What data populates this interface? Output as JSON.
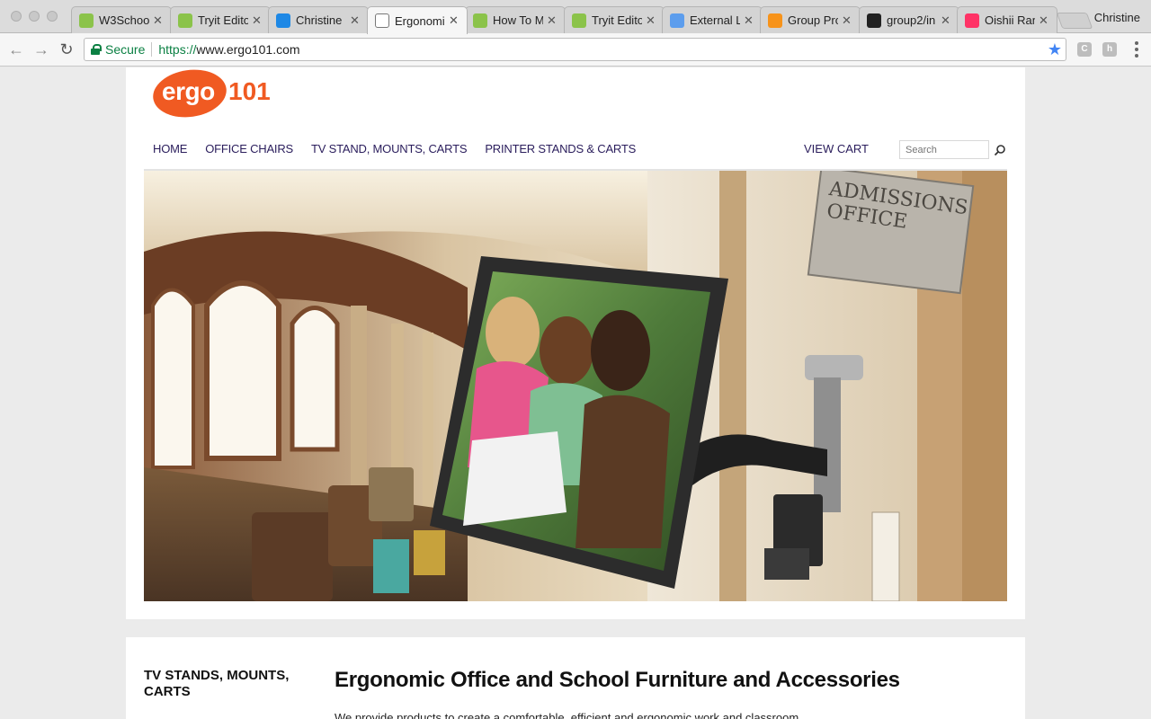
{
  "browser": {
    "tabs": [
      {
        "label": "W3Schoo",
        "icon": "w3schools-icon",
        "color": "#8bc34a"
      },
      {
        "label": "Tryit Edito",
        "icon": "w3schools-icon",
        "color": "#8bc34a"
      },
      {
        "label": "Christine",
        "icon": "codesandbox-icon",
        "color": "#1e88e5"
      },
      {
        "label": "Ergonomi",
        "icon": "page-icon",
        "color": "#ffffff"
      },
      {
        "label": "How To M",
        "icon": "w3schools-icon",
        "color": "#8bc34a"
      },
      {
        "label": "Tryit Edito",
        "icon": "w3schools-icon",
        "color": "#8bc34a"
      },
      {
        "label": "External L",
        "icon": "cloud-icon",
        "color": "#5c9ded"
      },
      {
        "label": "Group Pro",
        "icon": "bitcoin-icon",
        "color": "#f7931a"
      },
      {
        "label": "group2/in",
        "icon": "github-icon",
        "color": "#222222"
      },
      {
        "label": "Oishii Ran",
        "icon": "invision-icon",
        "color": "#ff3366"
      }
    ],
    "profile_name": "Christine",
    "secure_label": "Secure",
    "url_scheme": "https://",
    "url_host": "www.ergo101.com"
  },
  "site": {
    "logo_ergo": "ergo",
    "logo_num": "101",
    "nav": [
      "HOME",
      "OFFICE CHAIRS",
      "TV STAND, MOUNTS, CARTS",
      "PRINTER STANDS & CARTS"
    ],
    "view_cart": "VIEW CART",
    "search_placeholder": "Search",
    "brand_color": "#f05a22",
    "nav_color": "#2a1d5c",
    "hero": {
      "sign_line1": "ADMISSIONS",
      "sign_line2": "OFFICE"
    },
    "sidebar_heading": "TV STANDS, MOUNTS, CARTS",
    "main_heading": "Ergonomic Office and School Furniture and Accessories",
    "intro_text": "We provide products to create a comfortable, efficient and ergonomic work and classroom"
  }
}
